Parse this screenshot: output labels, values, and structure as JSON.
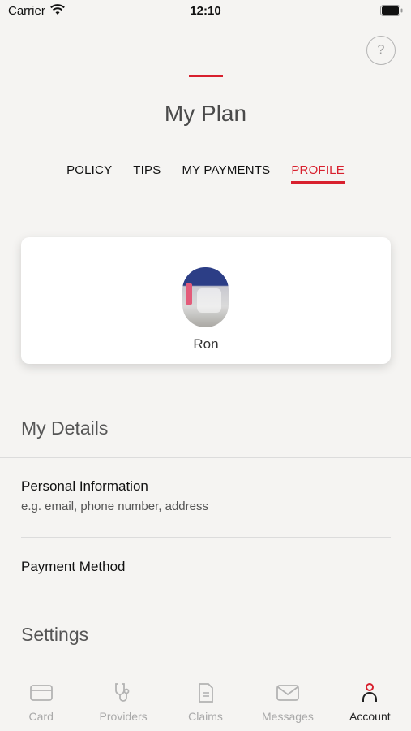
{
  "status_bar": {
    "carrier": "Carrier",
    "time": "12:10"
  },
  "header": {
    "title": "My Plan",
    "help_label": "?"
  },
  "tabs": [
    {
      "label": "POLICY",
      "active": false
    },
    {
      "label": "TIPS",
      "active": false
    },
    {
      "label": "MY PAYMENTS",
      "active": false
    },
    {
      "label": "PROFILE",
      "active": true
    }
  ],
  "profile": {
    "name": "Ron"
  },
  "details": {
    "title": "My Details",
    "items": [
      {
        "title": "Personal Information",
        "subtitle": "e.g. email, phone number, address"
      },
      {
        "title": "Payment Method",
        "subtitle": ""
      }
    ]
  },
  "settings": {
    "title": "Settings"
  },
  "bottom_nav": [
    {
      "label": "Card",
      "icon": "card-icon",
      "active": false
    },
    {
      "label": "Providers",
      "icon": "stethoscope-icon",
      "active": false
    },
    {
      "label": "Claims",
      "icon": "document-icon",
      "active": false
    },
    {
      "label": "Messages",
      "icon": "envelope-icon",
      "active": false
    },
    {
      "label": "Account",
      "icon": "person-icon",
      "active": true
    }
  ],
  "colors": {
    "accent": "#d8202e",
    "background": "#f5f4f2",
    "inactive": "#a9a9a9"
  }
}
